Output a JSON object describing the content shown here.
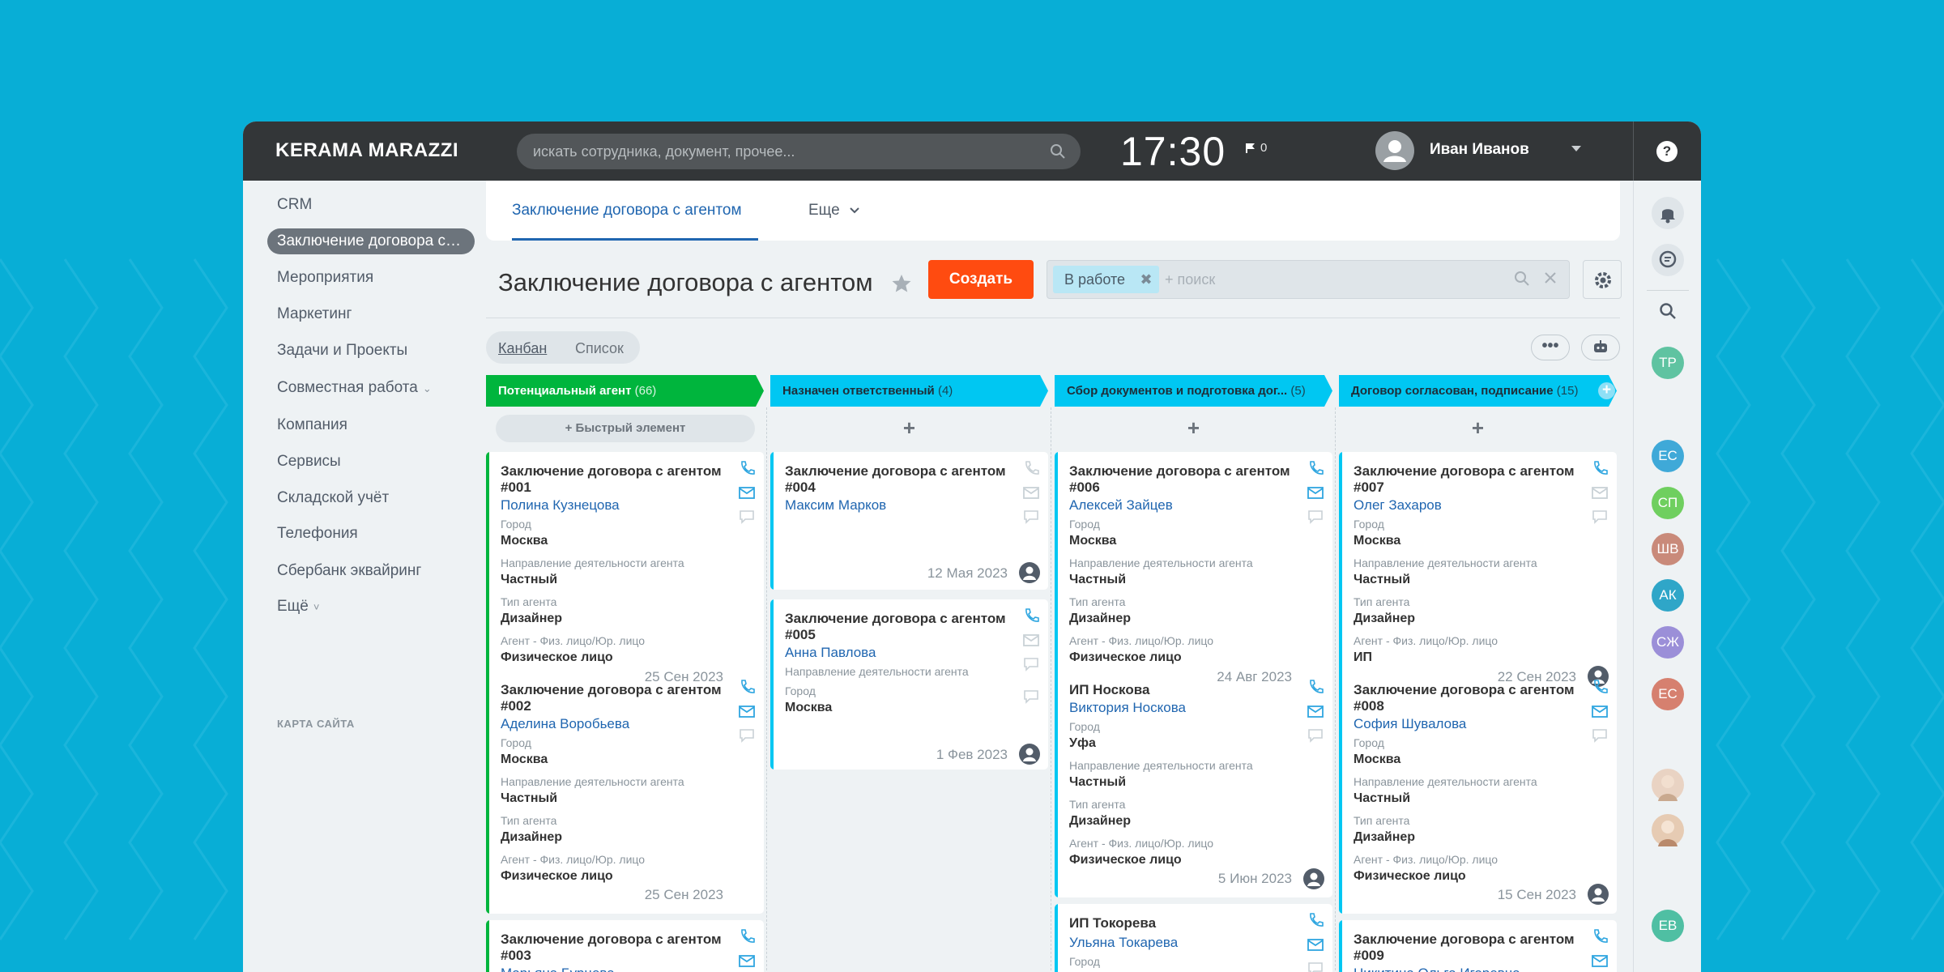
{
  "brand": "KERAMA MARAZZI",
  "search": {
    "placeholder": "искать сотрудника, документ, прочее..."
  },
  "clock": "17:30",
  "flag_count": "0",
  "user": {
    "name": "Иван Иванов"
  },
  "help": "?",
  "sidebar": {
    "items": [
      {
        "label": "CRM"
      },
      {
        "label": "Заключение договора с агентом"
      },
      {
        "label": "Мероприятия"
      },
      {
        "label": "Маркетинг"
      },
      {
        "label": "Задачи и Проекты"
      },
      {
        "label": "Совместная работа"
      },
      {
        "label": "Компания"
      },
      {
        "label": "Сервисы"
      },
      {
        "label": "Складской учёт"
      },
      {
        "label": "Телефония"
      },
      {
        "label": "Сбербанк эквайринг"
      },
      {
        "label": "Ещё"
      }
    ],
    "sitemap": "КАРТА САЙТА"
  },
  "tabs": {
    "active": "Заключение договора с агентом",
    "more": "Еще"
  },
  "page": {
    "title": "Заключение договора с агентом",
    "create_label": "Создать",
    "filter_tag": "В работе",
    "filter_placeholder": "+ поиск"
  },
  "views": {
    "kanban": "Канбан",
    "list": "Список"
  },
  "dots": "•••",
  "colors": {
    "accent": "#2066b0",
    "create": "#ff4b10",
    "col1": "#00b53d",
    "col2": "#00c7f2",
    "col3": "#00c7f2",
    "col4": "#00c7f2"
  },
  "columns": [
    {
      "title": "Потенциальный агент",
      "count": "(66)",
      "quick_add": "Быстрый элемент"
    },
    {
      "title": "Назначен ответственный",
      "count": "(4)"
    },
    {
      "title": "Сбор документов и подготовка дог...",
      "count": "(5)"
    },
    {
      "title": "Договор согласован, подписание",
      "count": "(15)"
    }
  ],
  "labels": {
    "city": "Город",
    "direction": "Направление деятельности агента",
    "type": "Тип агента",
    "person": "Агент - Физ. лицо/Юр. лицо"
  },
  "cards": {
    "c001": {
      "title": "Заключение договора с агентом #001",
      "client": "Полина Кузнецова",
      "city": "Москва",
      "direction": "Частный",
      "type": "Дизайнер",
      "person": "Физическое лицо",
      "date": "25 Сен 2023"
    },
    "c002": {
      "title": "Заключение договора с агентом #002",
      "client": "Аделина Воробьева",
      "city": "Москва",
      "direction": "Частный",
      "type": "Дизайнер",
      "person": "Физическое лицо",
      "date": "25 Сен 2023"
    },
    "c003": {
      "title": "Заключение договора с агентом #003",
      "client": "Марьяна Бурцева"
    },
    "c004": {
      "title": "Заключение договора с агентом #004",
      "client": "Максим Марков",
      "date": "12 Мая 2023"
    },
    "c005": {
      "title": "Заключение договора с агентом #005",
      "client": "Анна Павлова",
      "city": "Москва",
      "date": "1 Фев 2023"
    },
    "c006": {
      "title": "Заключение договора с агентом #006",
      "client": "Алексей Зайцев",
      "city": "Москва",
      "direction": "Частный",
      "type": "Дизайнер",
      "person": "Физическое лицо",
      "date": "24 Авг 2023"
    },
    "c_nos": {
      "title": "ИП Носкова",
      "client": "Виктория Носкова",
      "city": "Уфа",
      "direction": "Частный",
      "type": "Дизайнер",
      "person": "Физическое лицо",
      "date": "5 Июн 2023"
    },
    "c_tok": {
      "title": "ИП Токорева",
      "client": "Ульяна Токарева"
    },
    "c007": {
      "title": "Заключение договора с агентом #007",
      "client": "Олег Захаров",
      "city": "Москва",
      "direction": "Частный",
      "type": "Дизайнер",
      "person": "ИП",
      "date": "22 Сен 2023"
    },
    "c008": {
      "title": "Заключение договора с агентом #008",
      "client": "София Шувалова",
      "city": "Москва",
      "direction": "Частный",
      "type": "Дизайнер",
      "person": "Физическое лицо",
      "date": "15 Сен 2023"
    },
    "c009": {
      "title": "Заключение договора с агентом #009",
      "client": "Никитина Ольга Игоревна"
    }
  },
  "right_avatars": [
    "ТР",
    "ЕС",
    "СП",
    "ШВ",
    "АК",
    "СЖ",
    "ЕС",
    "ЕВ"
  ]
}
